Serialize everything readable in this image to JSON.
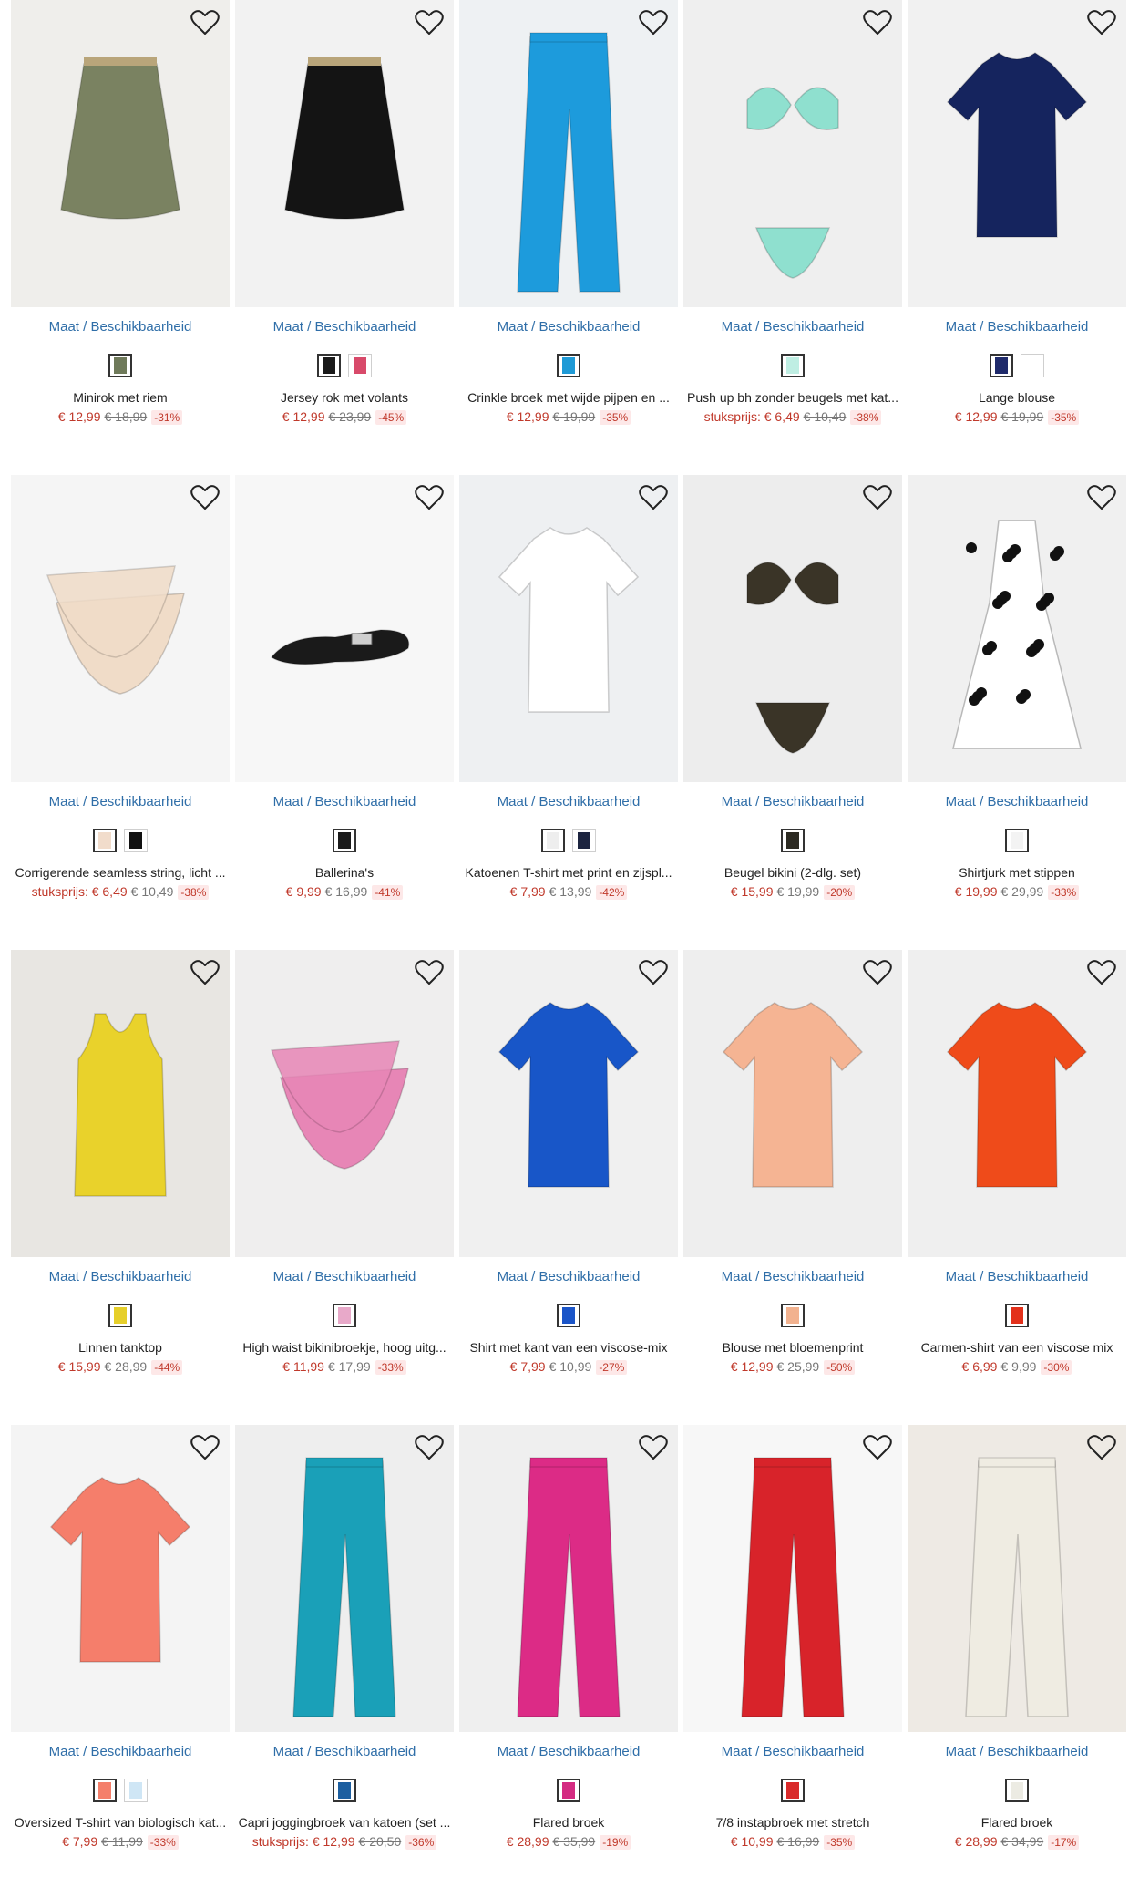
{
  "ui": {
    "size_link": "Maat / Beschikbaarheid"
  },
  "colors": {
    "link": "#2f6ea8",
    "sale": "#c0392b",
    "badge_bg": "#fde8e8"
  },
  "products": [
    {
      "name": "Minirok met riem",
      "price_prefix": "",
      "price": "€ 12,99",
      "old_price": "€ 18,99",
      "discount": "-31%",
      "swatches": [
        "#6f7a5a"
      ],
      "garment": "skirt",
      "color": "#7a8261",
      "bg": "#efeeeb"
    },
    {
      "name": "Jersey rok met volants",
      "price_prefix": "",
      "price": "€ 12,99",
      "old_price": "€ 23,99",
      "discount": "-45%",
      "swatches": [
        "#1a1a1a",
        "#d84a6a"
      ],
      "garment": "skirt",
      "color": "#141414",
      "bg": "#f2f2f2"
    },
    {
      "name": "Crinkle broek met wijde pijpen en ...",
      "price_prefix": "",
      "price": "€ 12,99",
      "old_price": "€ 19,99",
      "discount": "-35%",
      "swatches": [
        "#1f9ad6"
      ],
      "garment": "pants",
      "color": "#1d9bdc",
      "bg": "#eef1f3"
    },
    {
      "name": "Push up bh zonder beugels met kat...",
      "price_prefix": "stuksprijs: ",
      "price": "€ 6,49",
      "old_price": "€ 10,49",
      "discount": "-38%",
      "swatches": [
        "#bfeee3"
      ],
      "garment": "bikini",
      "color": "#8fe0cf",
      "bg": "#efefef"
    },
    {
      "name": "Lange blouse",
      "price_prefix": "",
      "price": "€ 12,99",
      "old_price": "€ 19,99",
      "discount": "-35%",
      "swatches": [
        "#1f2a6b",
        "#ffffff"
      ],
      "garment": "top",
      "color": "#15245e",
      "bg": "#f1f1f1"
    },
    {
      "name": "Corrigerende seamless string, licht ...",
      "price_prefix": "stuksprijs: ",
      "price": "€ 6,49",
      "old_price": "€ 10,49",
      "discount": "-38%",
      "swatches": [
        "#f1dccb",
        "#111111"
      ],
      "garment": "brief",
      "color": "#f0dcc8",
      "bg": "#f5f5f5"
    },
    {
      "name": "Ballerina's",
      "price_prefix": "",
      "price": "€ 9,99",
      "old_price": "€ 16,99",
      "discount": "-41%",
      "swatches": [
        "#1b1b1b"
      ],
      "garment": "shoe",
      "color": "#1a1a1a",
      "bg": "#f7f7f7"
    },
    {
      "name": "Katoenen T-shirt met print en zijspl...",
      "price_prefix": "",
      "price": "€ 7,99",
      "old_price": "€ 13,99",
      "discount": "-42%",
      "swatches": [
        "#eeeeee",
        "#1c2440"
      ],
      "garment": "tee",
      "color": "#ffffff",
      "bg": "#eef0f2"
    },
    {
      "name": "Beugel bikini (2-dlg. set)",
      "price_prefix": "",
      "price": "€ 15,99",
      "old_price": "€ 19,99",
      "discount": "-20%",
      "swatches": [
        "#2c2a22"
      ],
      "garment": "bikini",
      "color": "#3a3427",
      "bg": "#ededed"
    },
    {
      "name": "Shirtjurk met stippen",
      "price_prefix": "",
      "price": "€ 19,99",
      "old_price": "€ 29,99",
      "discount": "-33%",
      "swatches": [
        "#f3f3f3"
      ],
      "garment": "dress",
      "color": "#ffffff",
      "bg": "#f0f0f0"
    },
    {
      "name": "Linnen tanktop",
      "price_prefix": "",
      "price": "€ 15,99",
      "old_price": "€ 28,99",
      "discount": "-44%",
      "swatches": [
        "#e6cf2a"
      ],
      "garment": "tank",
      "color": "#e9d22b",
      "bg": "#e8e6e2"
    },
    {
      "name": "High waist bikinibroekje, hoog uitg...",
      "price_prefix": "",
      "price": "€ 11,99",
      "old_price": "€ 17,99",
      "discount": "-33%",
      "swatches": [
        "#e8a9c9"
      ],
      "garment": "brief",
      "color": "#e786b6",
      "bg": "#efeeee"
    },
    {
      "name": "Shirt met kant van een viscose-mix",
      "price_prefix": "",
      "price": "€ 7,99",
      "old_price": "€ 10,99",
      "discount": "-27%",
      "swatches": [
        "#1b55c8"
      ],
      "garment": "tee",
      "color": "#1856c8",
      "bg": "#f0f0f0"
    },
    {
      "name": "Blouse met bloemenprint",
      "price_prefix": "",
      "price": "€ 12,99",
      "old_price": "€ 25,99",
      "discount": "-50%",
      "swatches": [
        "#f2b28f"
      ],
      "garment": "tee",
      "color": "#f5b493",
      "bg": "#eeeeee"
    },
    {
      "name": "Carmen-shirt van een viscose mix",
      "price_prefix": "",
      "price": "€ 6,99",
      "old_price": "€ 9,99",
      "discount": "-30%",
      "swatches": [
        "#e3311b"
      ],
      "garment": "tee",
      "color": "#ef4b1a",
      "bg": "#efefef"
    },
    {
      "name": "Oversized T-shirt van biologisch kat...",
      "price_prefix": "",
      "price": "€ 7,99",
      "old_price": "€ 11,99",
      "discount": "-33%",
      "swatches": [
        "#f47f6b",
        "#cfe6f5"
      ],
      "garment": "tee",
      "color": "#f57e6b",
      "bg": "#f4f4f4"
    },
    {
      "name": "Capri joggingbroek van katoen (set ...",
      "price_prefix": "stuksprijs: ",
      "price": "€ 12,99",
      "old_price": "€ 20,50",
      "discount": "-36%",
      "swatches": [
        "#1d5fa0"
      ],
      "garment": "pants",
      "color": "#1aa0b8",
      "bg": "#eeeeee"
    },
    {
      "name": "Flared broek",
      "price_prefix": "",
      "price": "€ 28,99",
      "old_price": "€ 35,99",
      "discount": "-19%",
      "swatches": [
        "#d42b82"
      ],
      "garment": "pants",
      "color": "#dc2b86",
      "bg": "#efefef"
    },
    {
      "name": "7/8 instapbroek met stretch",
      "price_prefix": "",
      "price": "€ 10,99",
      "old_price": "€ 16,99",
      "discount": "-35%",
      "swatches": [
        "#d92a2a"
      ],
      "garment": "pants",
      "color": "#d8232a",
      "bg": "#f7f7f7"
    },
    {
      "name": "Flared broek",
      "price_prefix": "",
      "price": "€ 28,99",
      "old_price": "€ 34,99",
      "discount": "-17%",
      "swatches": [
        "#ecebe3"
      ],
      "garment": "pants",
      "color": "#efece2",
      "bg": "#eeeae4"
    }
  ]
}
